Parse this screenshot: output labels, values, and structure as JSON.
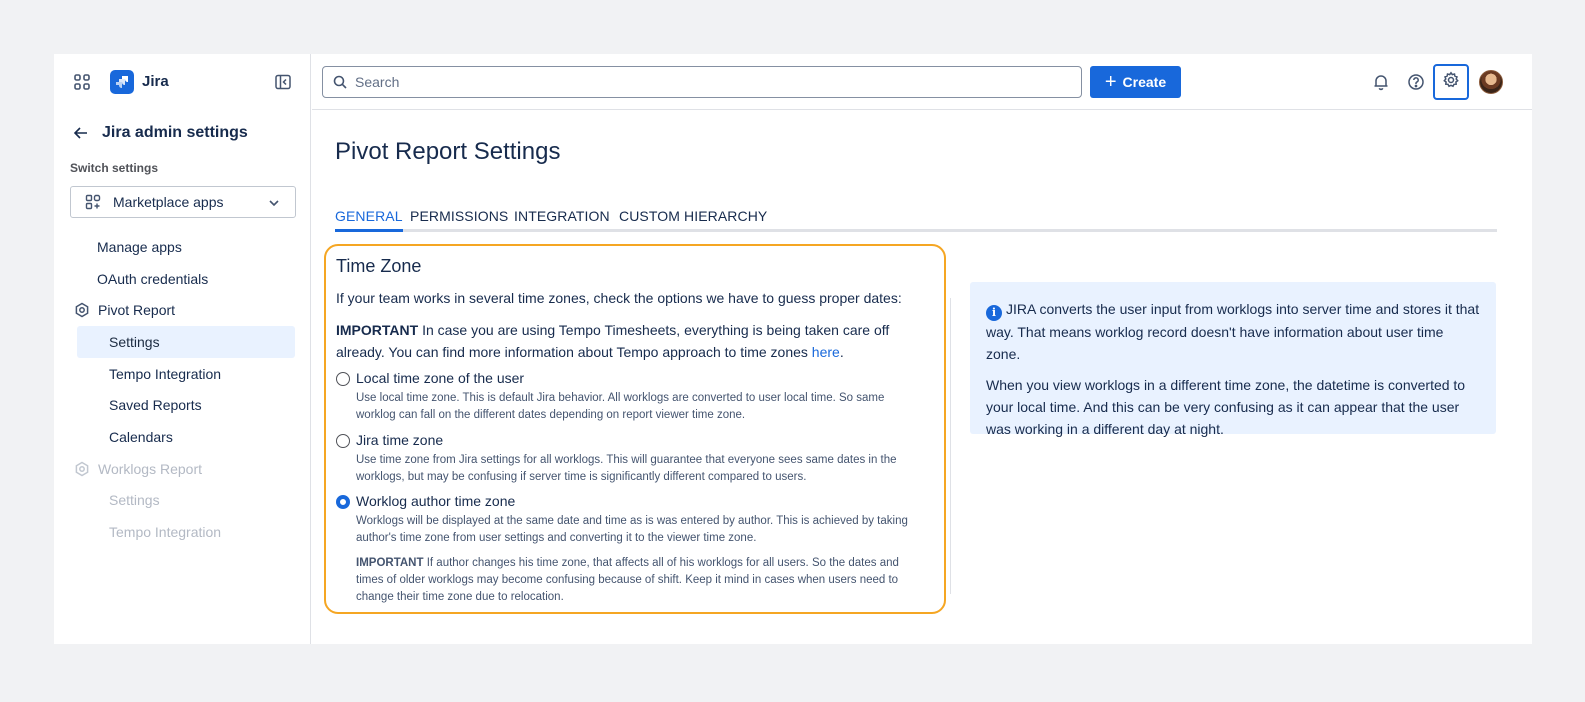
{
  "app": {
    "name": "Jira"
  },
  "sidebar": {
    "back_title": "Jira admin settings",
    "switch_label": "Switch settings",
    "switch_value": "Marketplace apps",
    "items": [
      {
        "label": "Manage apps",
        "state": "normal"
      },
      {
        "label": "OAuth credentials",
        "state": "normal"
      },
      {
        "label": "Pivot Report",
        "state": "section"
      },
      {
        "label": "Settings",
        "state": "active"
      },
      {
        "label": "Tempo Integration",
        "state": "normal"
      },
      {
        "label": "Saved Reports",
        "state": "normal"
      },
      {
        "label": "Calendars",
        "state": "normal"
      },
      {
        "label": "Worklogs Report",
        "state": "disabled-section"
      },
      {
        "label": "Settings",
        "state": "disabled"
      },
      {
        "label": "Tempo Integration",
        "state": "disabled"
      }
    ]
  },
  "topbar": {
    "search_placeholder": "Search",
    "create_label": "Create",
    "icons": [
      "bell-icon",
      "help-icon",
      "gear-icon",
      "avatar"
    ]
  },
  "main": {
    "page_title": "Pivot Report Settings",
    "tabs": [
      {
        "label": "GENERAL",
        "active": true
      },
      {
        "label": "PERMISSIONS",
        "active": false
      },
      {
        "label": "INTEGRATION",
        "active": false
      },
      {
        "label": "CUSTOM HIERARCHY",
        "active": false
      }
    ],
    "timezone": {
      "title": "Time Zone",
      "intro": "If your team works in several time zones, check the options we have to guess proper dates:",
      "important_label": "IMPORTANT",
      "important_text": " In case you are using Tempo Timesheets, everything is being taken care off already. You can find more information about Tempo approach to time zones ",
      "important_link": "here",
      "important_end": ".",
      "options": [
        {
          "label": "Local time zone of the user",
          "description": "Use local time zone. This is default Jira behavior. All worklogs are converted to user local time. So same worklog can fall on the different dates depending on report viewer time zone.",
          "checked": false
        },
        {
          "label": "Jira time zone",
          "description": "Use time zone from Jira settings for all worklogs. This will guarantee that everyone sees same dates in the worklogs, but may be confusing if server time is significantly different compared to users.",
          "checked": false
        },
        {
          "label": "Worklog author time zone",
          "description": "Worklogs will be displayed at the same date and time as is was entered by author. This is achieved by taking author's time zone from user settings and converting it to the viewer time zone.",
          "note_label": "IMPORTANT",
          "note_text": " If author changes his time zone, that affects all of his worklogs for all users. So the dates and times of older worklogs may become confusing because of shift. Keep it mind in cases when users need to change their time zone due to relocation.",
          "checked": true
        }
      ]
    },
    "info": {
      "paragraph1": "JIRA converts the user input from worklogs into server time and stores it that way. That means worklog record doesn't have information about user time zone.",
      "paragraph2": "When you view worklogs in a different time zone, the datetime is converted to your local time. And this can be very confusing as it can appear that the user was working in a different day at night."
    }
  },
  "colors": {
    "accent": "#1868db",
    "highlight_border": "#f5a623",
    "info_bg": "#e9f2ff"
  }
}
